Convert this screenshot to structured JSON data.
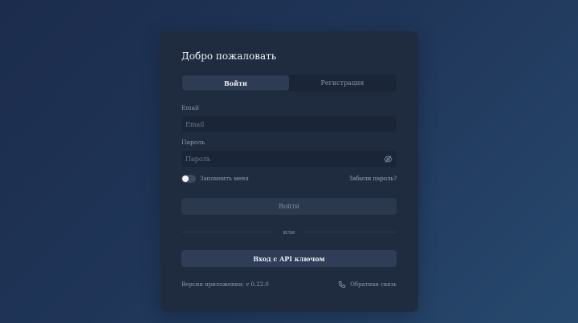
{
  "card": {
    "title": "Добро пожаловать"
  },
  "tabs": [
    {
      "label": "Войти",
      "active": true
    },
    {
      "label": "Регистрация",
      "active": false
    }
  ],
  "form": {
    "email_label": "Email",
    "email_placeholder": "Email",
    "email_value": "",
    "password_label": "Пароль",
    "password_placeholder": "Пароль",
    "password_value": "",
    "password_visibility_icon": "eye-off-icon",
    "remember_label": "Запомнить меня",
    "remember_checked": false,
    "forgot_label": "Забыли пароль?",
    "login_button": "Войти",
    "divider_text": "или",
    "api_button": "Вход с API ключом"
  },
  "footer": {
    "version_text": "Версия приложения: v 0.22.0",
    "feedback_label": "Обратная связь",
    "feedback_icon": "phone-icon"
  },
  "colors": {
    "background_start": "#1c2c4c",
    "background_end": "#27496e",
    "card": "#1f2c40",
    "input": "#1a2637",
    "active_tab": "#2d3c52",
    "api_button": "#2f3e56",
    "login_button": "#2b394e"
  }
}
